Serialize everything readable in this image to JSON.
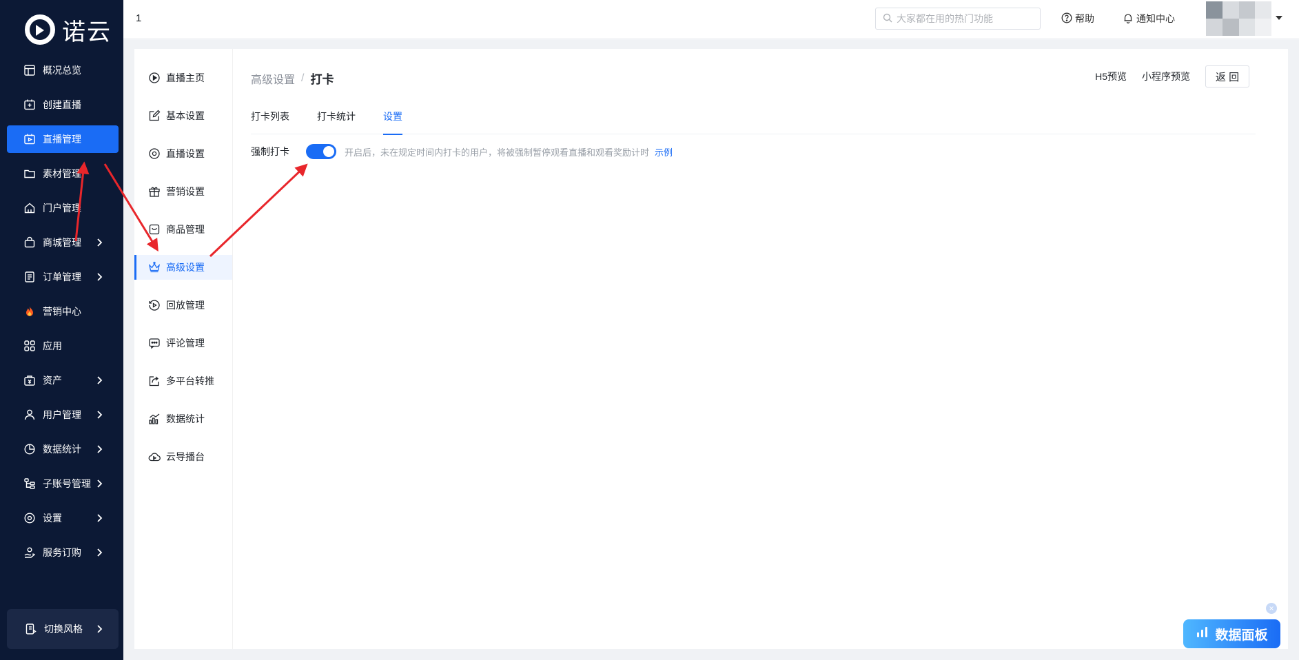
{
  "app": {
    "logo_text": "诺云"
  },
  "sidebar": {
    "items": [
      {
        "label": "概况总览",
        "icon": "dashboard-icon",
        "has_children": false,
        "active": false
      },
      {
        "label": "创建直播",
        "icon": "add-live-icon",
        "has_children": false,
        "active": false
      },
      {
        "label": "直播管理",
        "icon": "live-manage-icon",
        "has_children": false,
        "active": true
      },
      {
        "label": "素材管理",
        "icon": "folder-icon",
        "has_children": false,
        "active": false
      },
      {
        "label": "门户管理",
        "icon": "home-icon",
        "has_children": false,
        "active": false
      },
      {
        "label": "商城管理",
        "icon": "shop-bag-icon",
        "has_children": true,
        "active": false
      },
      {
        "label": "订单管理",
        "icon": "order-icon",
        "has_children": true,
        "active": false
      },
      {
        "label": "营销中心",
        "icon": "fire-icon",
        "has_children": false,
        "active": false
      },
      {
        "label": "应用",
        "icon": "apps-grid-icon",
        "has_children": false,
        "active": false
      },
      {
        "label": "资产",
        "icon": "asset-icon",
        "has_children": true,
        "active": false
      },
      {
        "label": "用户管理",
        "icon": "user-icon",
        "has_children": true,
        "active": false
      },
      {
        "label": "数据统计",
        "icon": "pie-chart-icon",
        "has_children": true,
        "active": false
      },
      {
        "label": "子账号管理",
        "icon": "sub-account-icon",
        "has_children": true,
        "active": false
      },
      {
        "label": "设置",
        "icon": "settings-icon",
        "has_children": true,
        "active": false
      },
      {
        "label": "服务订购",
        "icon": "service-icon",
        "has_children": true,
        "active": false
      }
    ],
    "switch_style_label": "切换风格"
  },
  "header": {
    "title": "1",
    "search_placeholder": "大家都在用的热门功能",
    "help_label": "帮助",
    "notify_label": "通知中心"
  },
  "subnav": {
    "items": [
      {
        "label": "直播主页",
        "icon": "play-circle-icon",
        "active": false
      },
      {
        "label": "基本设置",
        "icon": "edit-icon",
        "active": false
      },
      {
        "label": "直播设置",
        "icon": "gear-icon",
        "active": false
      },
      {
        "label": "营销设置",
        "icon": "gift-icon",
        "active": false
      },
      {
        "label": "商品管理",
        "icon": "goods-icon",
        "active": false
      },
      {
        "label": "高级设置",
        "icon": "crown-icon",
        "active": true
      },
      {
        "label": "回放管理",
        "icon": "replay-icon",
        "active": false
      },
      {
        "label": "评论管理",
        "icon": "comment-icon",
        "active": false
      },
      {
        "label": "多平台转推",
        "icon": "share-icon",
        "active": false
      },
      {
        "label": "数据统计",
        "icon": "bar-chart-icon",
        "active": false
      },
      {
        "label": "云导播台",
        "icon": "cloud-play-icon",
        "active": false
      }
    ]
  },
  "main": {
    "breadcrumb_parent": "高级设置",
    "breadcrumb_separator": "/",
    "breadcrumb_current": "打卡",
    "h5_preview_label": "H5预览",
    "mini_preview_label": "小程序预览",
    "back_label": "返 回",
    "tabs": [
      {
        "label": "打卡列表",
        "active": false
      },
      {
        "label": "打卡统计",
        "active": false
      },
      {
        "label": "设置",
        "active": true
      }
    ],
    "setting": {
      "label": "强制打卡",
      "enabled": true,
      "description": "开启后，未在规定时间内打卡的用户，将被强制暂停观看直播和观看奖励计时",
      "example_link": "示例"
    }
  },
  "floating_panel": {
    "label": "数据面板",
    "close_symbol": "×"
  },
  "colors": {
    "sidebar_bg": "#0c1935",
    "accent": "#1a6cf5",
    "annotation_arrow": "#e8262b"
  }
}
